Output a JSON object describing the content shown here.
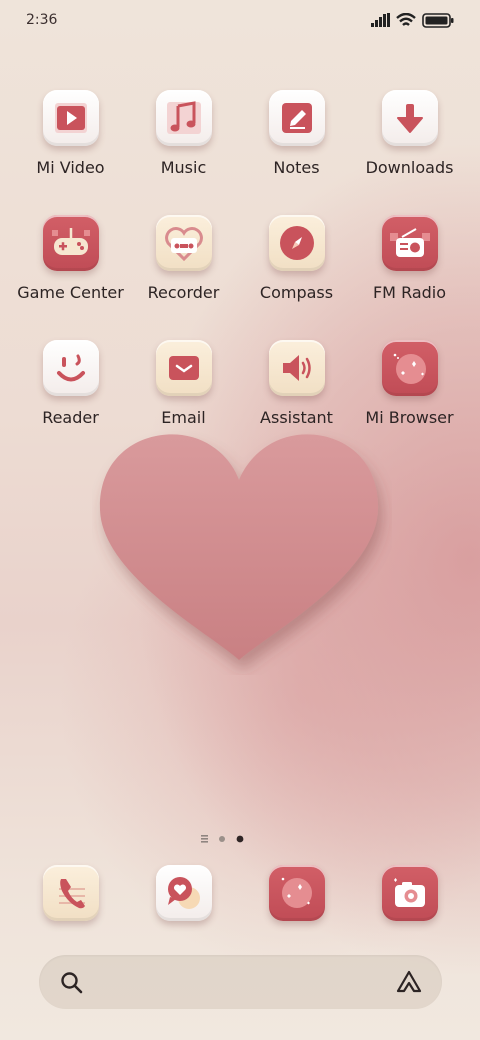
{
  "status_bar": {
    "time": "2:36"
  },
  "apps": [
    {
      "label": "Mi Video"
    },
    {
      "label": "Music"
    },
    {
      "label": "Notes"
    },
    {
      "label": "Downloads"
    },
    {
      "label": "Game Center"
    },
    {
      "label": "Recorder"
    },
    {
      "label": "Compass"
    },
    {
      "label": "FM Radio"
    },
    {
      "label": "Reader"
    },
    {
      "label": "Email"
    },
    {
      "label": "Assistant"
    },
    {
      "label": "Mi Browser"
    }
  ],
  "page_indicator": {
    "pages": 3,
    "current": 3
  },
  "dock": [
    {
      "icon": "phone-icon"
    },
    {
      "icon": "messages-icon"
    },
    {
      "icon": "gallery-icon"
    },
    {
      "icon": "camera-icon"
    }
  ],
  "colors": {
    "accent": "#c9535c",
    "cream": "#f6e7d0",
    "heart": "#d48f91"
  }
}
